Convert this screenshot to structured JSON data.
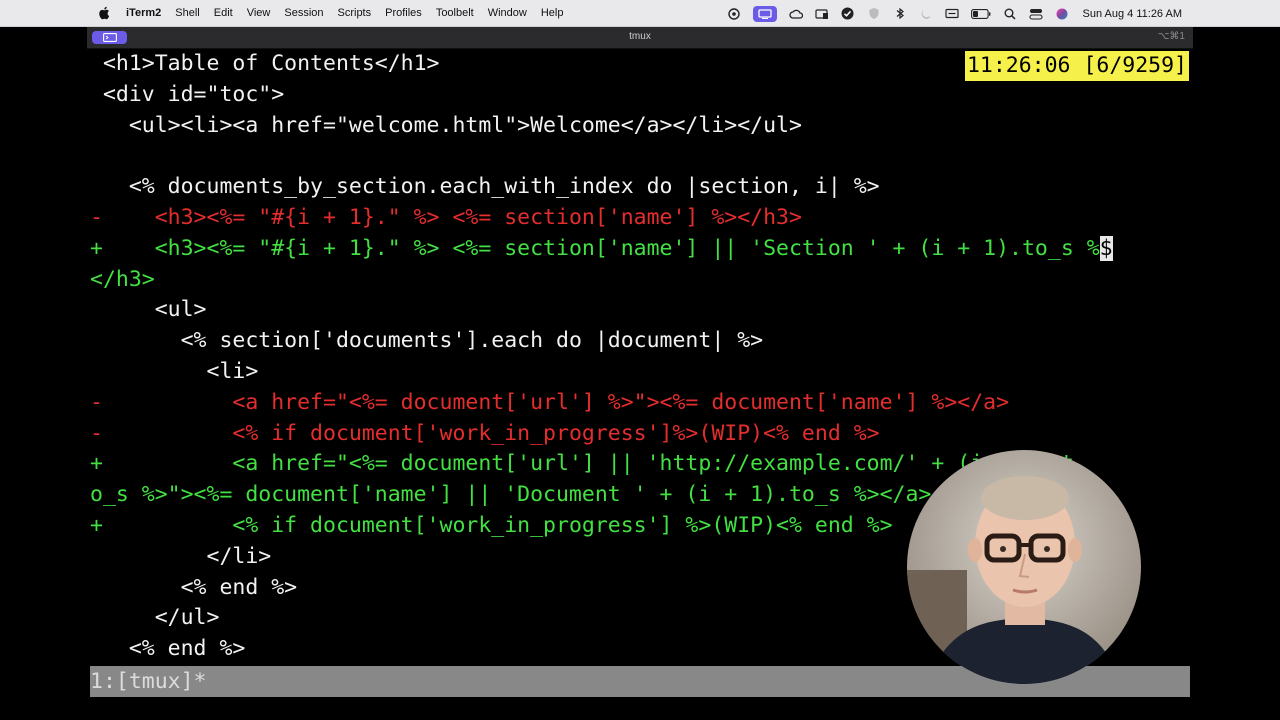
{
  "menubar": {
    "items": [
      "iTerm2",
      "Shell",
      "Edit",
      "View",
      "Session",
      "Scripts",
      "Profiles",
      "Toolbelt",
      "Window",
      "Help"
    ],
    "datetime": "Sun Aug 4  11:26 AM"
  },
  "window": {
    "title": "tmux",
    "shortcut": "⌥⌘1"
  },
  "terminal": {
    "clock": "11:26:06 [6/9259]",
    "lines": [
      {
        "prefix": " ",
        "text": "<h1>Table of Contents</h1>",
        "color": "white"
      },
      {
        "prefix": " ",
        "text": "<div id=\"toc\">",
        "color": "white"
      },
      {
        "prefix": " ",
        "text": "  <ul><li><a href=\"welcome.html\">Welcome</a></li></ul>",
        "color": "white"
      },
      {
        "prefix": " ",
        "text": "",
        "color": "white"
      },
      {
        "prefix": " ",
        "text": "  <% documents_by_section.each_with_index do |section, i| %>",
        "color": "white"
      },
      {
        "prefix": "-",
        "text": "    <h3><%= \"#{i + 1}.\" %> <%= section['name'] %></h3>",
        "color": "red"
      },
      {
        "prefix": "+",
        "text": "    <h3><%= \"#{i + 1}.\" %> <%= section['name'] || 'Section ' + (i + 1).to_s %",
        "color": "green",
        "cursor": "$"
      },
      {
        "prefix": "",
        "text": "</h3>",
        "color": "green"
      },
      {
        "prefix": " ",
        "text": "    <ul>",
        "color": "white"
      },
      {
        "prefix": " ",
        "text": "      <% section['documents'].each do |document| %>",
        "color": "white"
      },
      {
        "prefix": " ",
        "text": "        <li>",
        "color": "white"
      },
      {
        "prefix": "-",
        "text": "          <a href=\"<%= document['url'] %>\"><%= document['name'] %></a>",
        "color": "red"
      },
      {
        "prefix": "-",
        "text": "          <% if document['work_in_progress']%>(WIP)<% end %>",
        "color": "red"
      },
      {
        "prefix": "+",
        "text": "          <a href=\"<%= document['url'] || 'http://example.com/' + (i + 1).t",
        "color": "green"
      },
      {
        "prefix": "",
        "text": "o_s %>\"><%= document['name'] || 'Document ' + (i + 1).to_s %></a>",
        "color": "green"
      },
      {
        "prefix": "+",
        "text": "          <% if document['work_in_progress'] %>(WIP)<% end %>",
        "color": "green"
      },
      {
        "prefix": " ",
        "text": "        </li>",
        "color": "white"
      },
      {
        "prefix": " ",
        "text": "      <% end %>",
        "color": "white"
      },
      {
        "prefix": " ",
        "text": "    </ul>",
        "color": "white"
      },
      {
        "prefix": " ",
        "text": "  <% end %>",
        "color": "white"
      }
    ],
    "status": "1:[tmux]*"
  },
  "colors": {
    "red": "#e42d2d",
    "green": "#43e043",
    "clock_bg": "#f5f04a",
    "status_bg": "#888888",
    "accent": "#6b5ce7"
  },
  "icons": [
    "apple-icon",
    "control-center-icon",
    "stage-manager-icon",
    "creative-cloud-icon",
    "drive-icon",
    "check-icon",
    "bluetooth-icon",
    "moon-icon",
    "keyboard-icon",
    "battery-icon",
    "search-icon",
    "switches-icon",
    "siri-icon"
  ]
}
